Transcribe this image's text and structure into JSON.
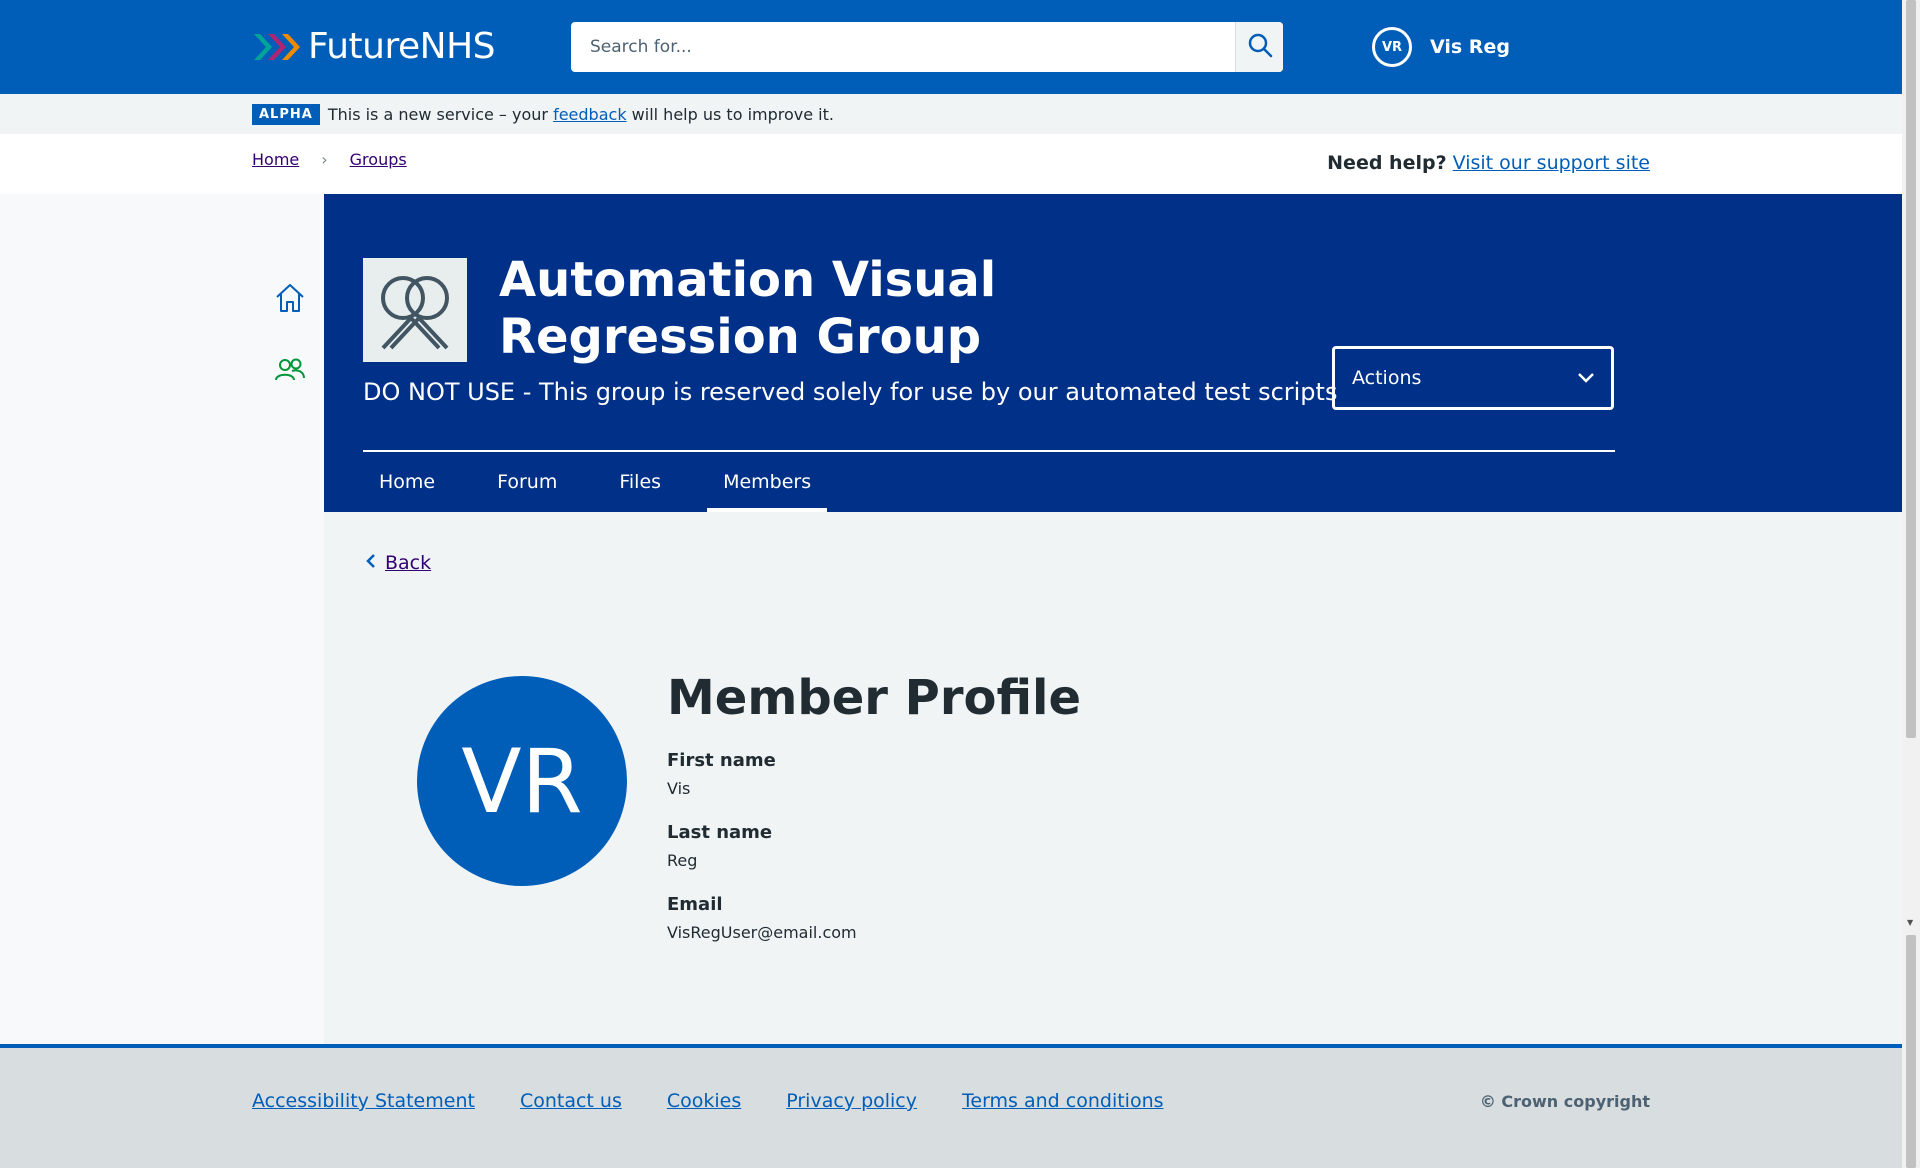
{
  "header": {
    "logo_text": "FutureNHS",
    "search_placeholder": "Search for...",
    "user_initials": "VR",
    "user_name": "Vis Reg"
  },
  "phase_banner": {
    "tag": "ALPHA",
    "text_before": "This is a new service – your",
    "link": "feedback",
    "text_after": "will help us to improve it."
  },
  "breadcrumb": {
    "items": [
      "Home",
      "Groups"
    ],
    "help_label": "Need help?",
    "help_link": "Visit our support site"
  },
  "group": {
    "title": "Automation Visual Regression Group",
    "description": "DO NOT USE - This group is reserved solely for use by our automated test scripts",
    "actions_label": "Actions",
    "tabs": [
      "Home",
      "Forum",
      "Files",
      "Members"
    ],
    "active_tab": "Members"
  },
  "main": {
    "back_label": "Back",
    "avatar_initials": "VR",
    "heading": "Member Profile",
    "fields": [
      {
        "label": "First name",
        "value": "Vis"
      },
      {
        "label": "Last name",
        "value": "Reg"
      },
      {
        "label": "Email",
        "value": "VisRegUser@email.com"
      }
    ]
  },
  "footer": {
    "links": [
      "Accessibility Statement",
      "Contact us",
      "Cookies",
      "Privacy policy",
      "Terms and conditions"
    ],
    "copyright": "© Crown copyright"
  },
  "colors": {
    "nhs_blue": "#005eb8",
    "dark_blue": "#003087",
    "link_visited": "#330072"
  }
}
